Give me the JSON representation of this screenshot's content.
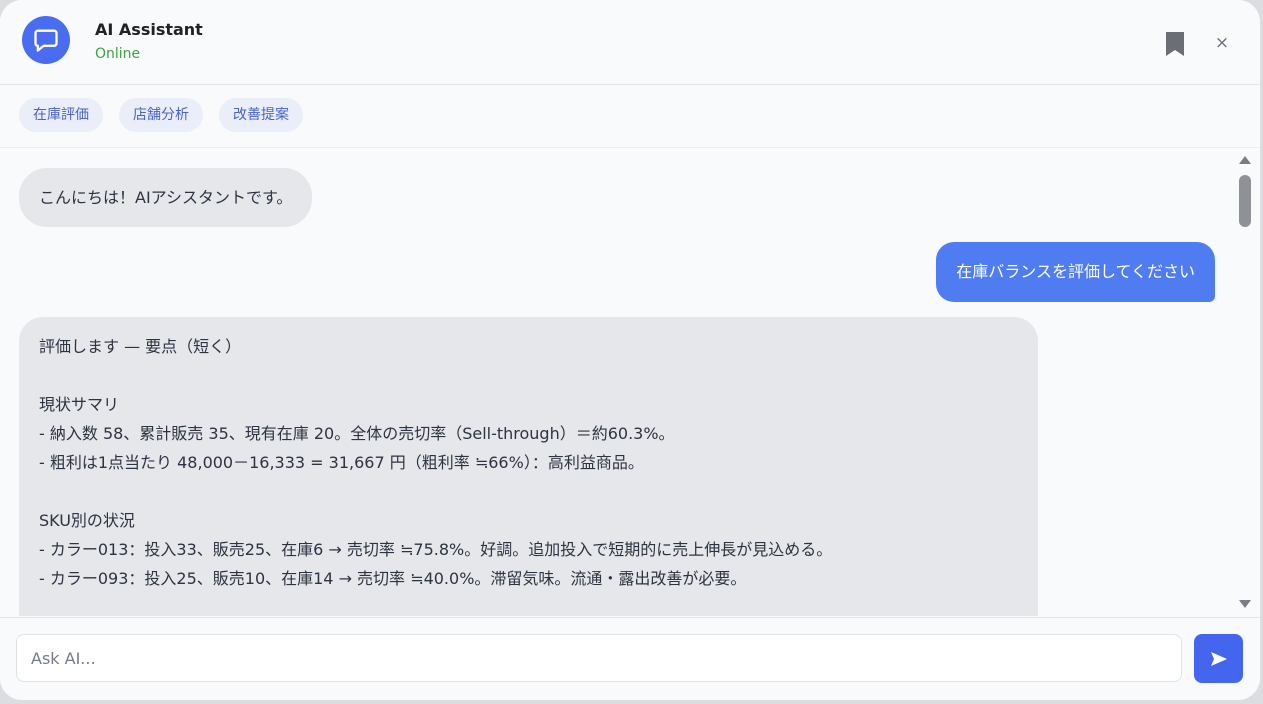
{
  "header": {
    "title": "AI Assistant",
    "status": "Online",
    "close_label": "×"
  },
  "chips": [
    "在庫評価",
    "店舗分析",
    "改善提案"
  ],
  "messages": [
    {
      "role": "assistant",
      "text": "こんにちは！AIアシスタントです。"
    },
    {
      "role": "user",
      "text": "在庫バランスを評価してください"
    },
    {
      "role": "assistant",
      "text": "評価します — 要点（短く）\n\n現状サマリ\n- 納入数 58、累計販売 35、現有在庫 20。全体の売切率（Sell-through）＝約60.3%。\n- 粗利は1点当たり 48,000－16,333 = 31,667 円（粗利率 ≒66%）：高利益商品。\n\nSKU別の状況\n- カラー013：投入33、販売25、在庫6 → 売切率 ≒75.8%。好調。追加投入で短期的に売上伸長が見込める。\n- カラー093：投入25、販売10、在庫14 → 売切率 ≒40.0%。滞留気味。流通・露出改善が必要。"
    }
  ],
  "input": {
    "placeholder": "Ask AI..."
  },
  "colors": {
    "accent": "#4466ee",
    "user_bubble": "#4f7df1",
    "status": "#3aa340"
  },
  "icons": {
    "avatar": "chat-bubble-icon",
    "bookmark": "bookmark-icon",
    "close": "close-icon",
    "send": "send-icon"
  }
}
